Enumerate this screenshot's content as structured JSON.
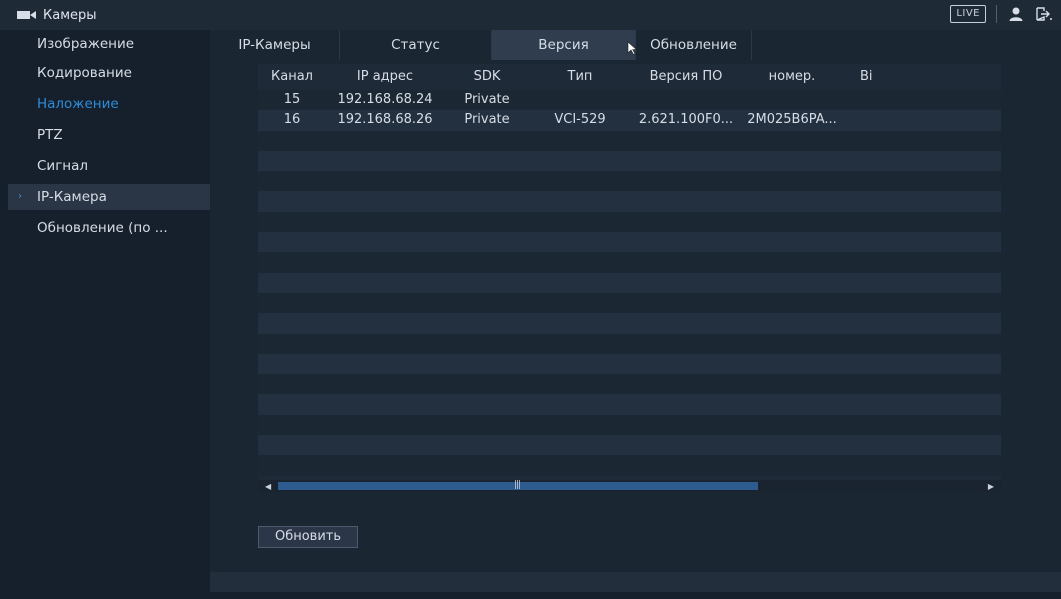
{
  "header": {
    "title": "Камеры",
    "live_label": "LIVE",
    "icons": [
      "camera-icon",
      "user-icon",
      "logout-icon"
    ]
  },
  "sidebar": {
    "items": [
      {
        "label": "Изображение"
      },
      {
        "label": "Кодирование"
      },
      {
        "label": "Наложение",
        "highlight": true
      },
      {
        "label": "PTZ"
      },
      {
        "label": "Сигнал"
      },
      {
        "label": "IP-Камера",
        "selected": true
      },
      {
        "label": "Обновление (по ..."
      }
    ]
  },
  "tabs": [
    {
      "label": "IP-Камеры"
    },
    {
      "label": "Статус"
    },
    {
      "label": "Версия",
      "active": true
    },
    {
      "label": "Обновление"
    }
  ],
  "table": {
    "columns": [
      "Канал",
      "IP адрес",
      "SDK",
      "Тип",
      "Версия ПО",
      "номер.",
      "Ві"
    ],
    "rows": [
      [
        "15",
        "192.168.68.24",
        "Private",
        "",
        "",
        "",
        ""
      ],
      [
        "16",
        "192.168.68.26",
        "Private",
        "VCI-529",
        "2.621.100F0...",
        "2M025B6PA...",
        ""
      ]
    ],
    "empty_rows": 17
  },
  "buttons": {
    "refresh": "Обновить"
  },
  "colors": {
    "accent": "#2e8bd8",
    "background": "#16202c",
    "panel": "#1b2633",
    "scroll_thumb": "#2d5b8e"
  }
}
